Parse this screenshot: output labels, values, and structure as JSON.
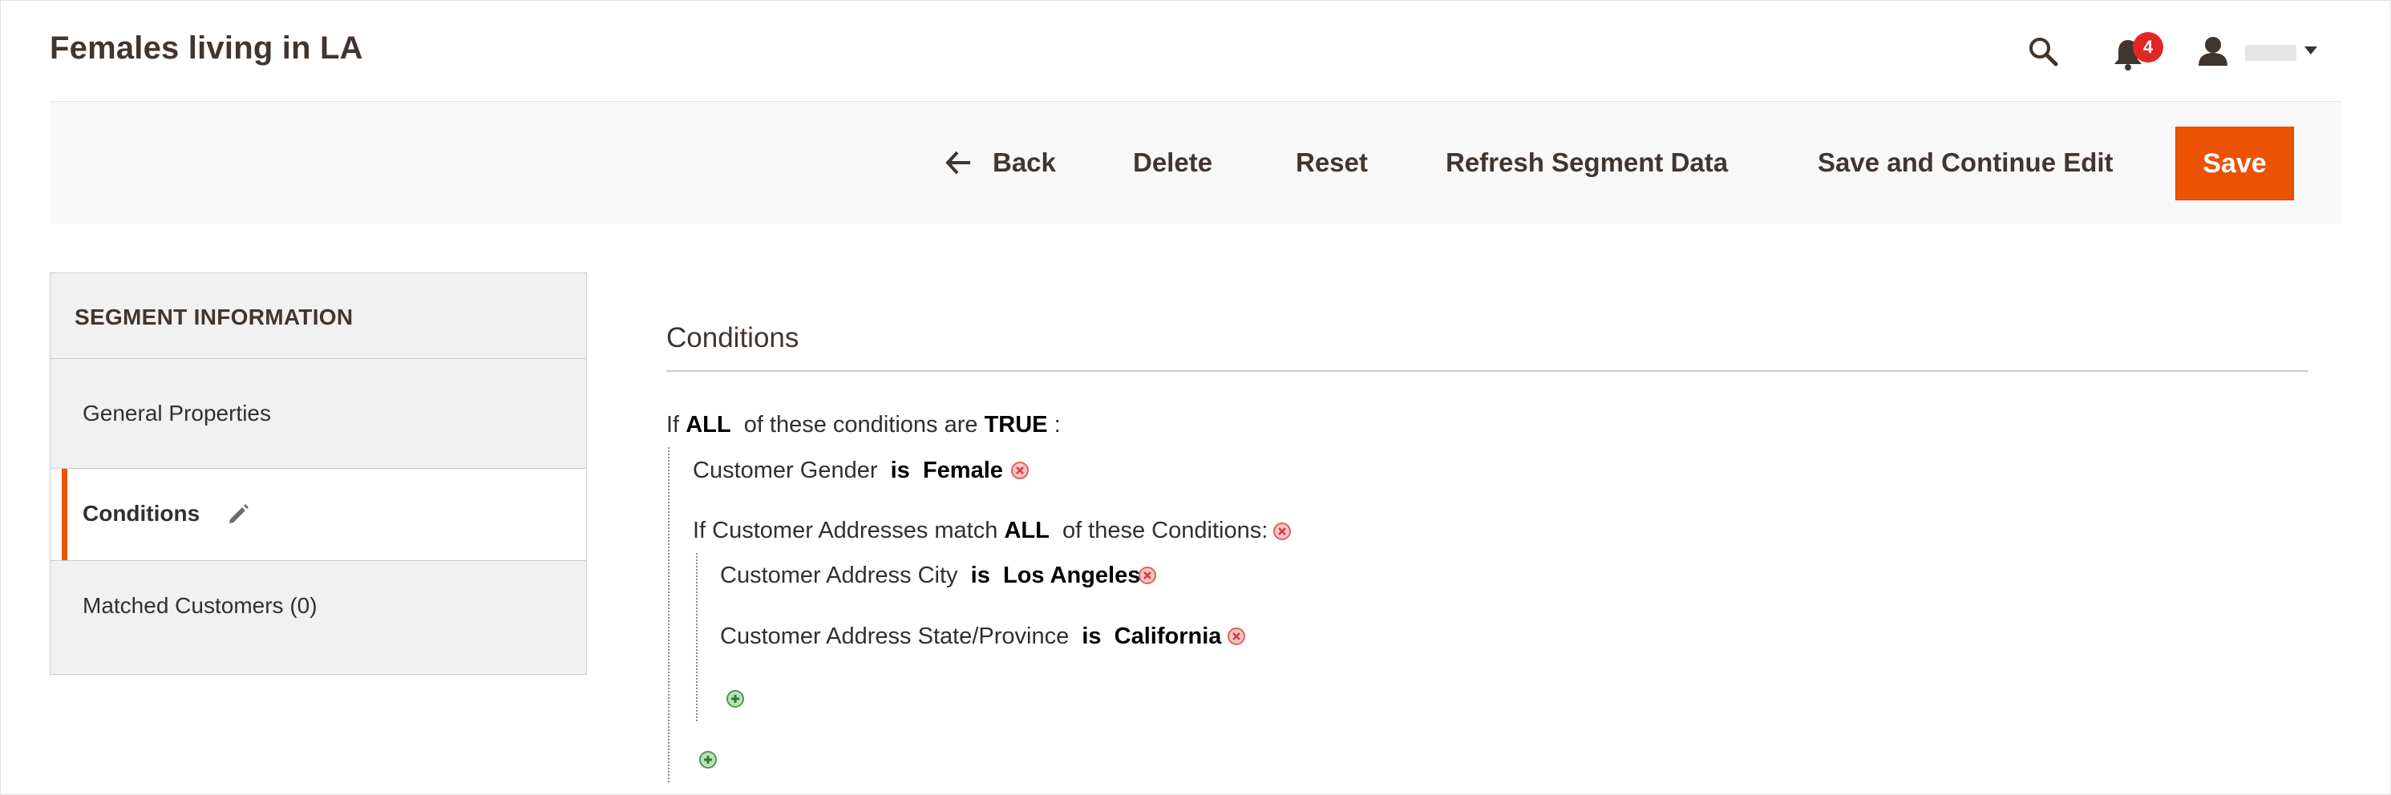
{
  "header": {
    "title": "Females living in LA",
    "notifications_count": "4",
    "user_name": ""
  },
  "toolbar": {
    "back_label": "Back",
    "delete_label": "Delete",
    "reset_label": "Reset",
    "refresh_label": "Refresh Segment Data",
    "save_continue_label": "Save and Continue Edit",
    "save_label": "Save"
  },
  "sidebar": {
    "heading": "SEGMENT INFORMATION",
    "items": [
      {
        "label": "General Properties",
        "active": false
      },
      {
        "label": "Conditions",
        "active": true
      },
      {
        "label": "Matched Customers (0)",
        "active": false
      }
    ]
  },
  "conditions": {
    "title": "Conditions",
    "root": {
      "prefix": "If",
      "aggregator": "ALL",
      "middle": "of these conditions are",
      "value": "TRUE",
      "suffix": ":"
    },
    "gender_rule": {
      "attribute": "Customer Gender",
      "operator": "is",
      "value": "Female"
    },
    "address_group": {
      "prefix": "If Customer Addresses match",
      "aggregator": "ALL",
      "suffix": "of these Conditions:"
    },
    "city_rule": {
      "attribute": "Customer Address City",
      "operator": "is",
      "value": "Los Angeles"
    },
    "state_rule": {
      "attribute": "Customer Address State/Province",
      "operator": "is",
      "value": "California"
    }
  },
  "colors": {
    "accent": "#eb5202",
    "badge": "#e22626",
    "remove_icon": "#e35f5f",
    "add_icon": "#4f9a4f"
  },
  "icons": [
    "search-icon",
    "bell-icon",
    "user-icon",
    "caret-down-icon",
    "arrow-left-icon",
    "pencil-icon",
    "remove-icon",
    "add-icon"
  ]
}
